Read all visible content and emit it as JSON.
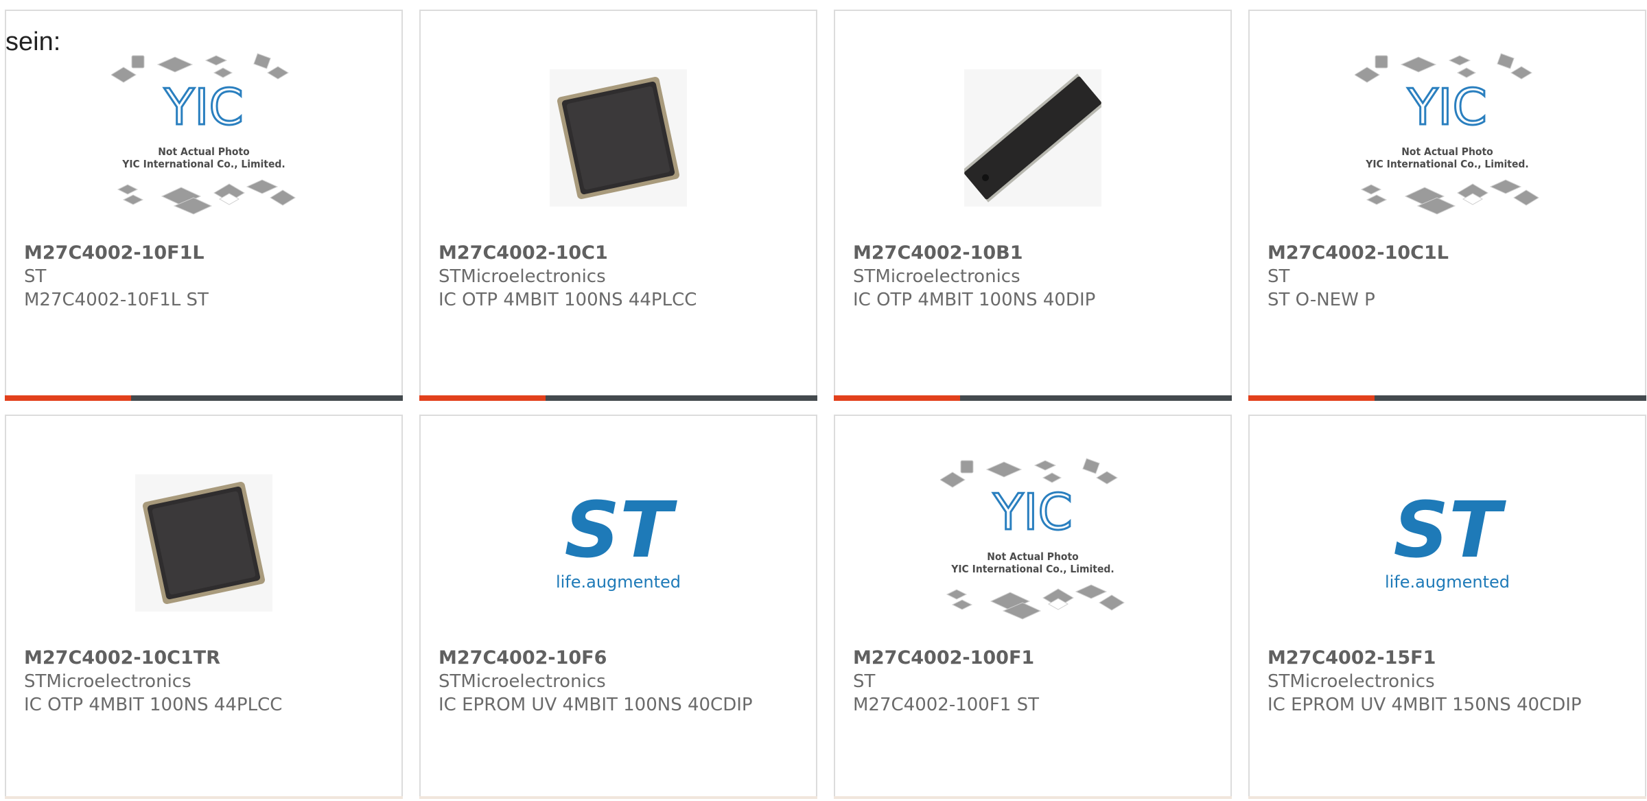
{
  "intro_text": "sein:",
  "colors": {
    "accent": "#e2401c",
    "bar": "#444a4e",
    "st_blue": "#1e7ab8"
  },
  "products": [
    {
      "part": "M27C4002-10F1L",
      "maker": "ST",
      "desc": "M27C4002-10F1L ST",
      "image": "yic-placeholder"
    },
    {
      "part": "M27C4002-10C1",
      "maker": "STMicroelectronics",
      "desc": "IC OTP 4MBIT 100NS 44PLCC",
      "image": "plcc-chip"
    },
    {
      "part": "M27C4002-10B1",
      "maker": "STMicroelectronics",
      "desc": "IC OTP 4MBIT 100NS 40DIP",
      "image": "dip-chip"
    },
    {
      "part": "M27C4002-10C1L",
      "maker": "ST",
      "desc": "ST O-NEW P",
      "image": "yic-placeholder"
    },
    {
      "part": "M27C4002-10C1TR",
      "maker": "STMicroelectronics",
      "desc": "IC OTP 4MBIT 100NS 44PLCC",
      "image": "plcc-chip"
    },
    {
      "part": "M27C4002-10F6",
      "maker": "STMicroelectronics",
      "desc": "IC EPROM UV 4MBIT 100NS 40CDIP",
      "image": "st-logo"
    },
    {
      "part": "M27C4002-100F1",
      "maker": "ST",
      "desc": "M27C4002-100F1 ST",
      "image": "yic-placeholder"
    },
    {
      "part": "M27C4002-15F1",
      "maker": "STMicroelectronics",
      "desc": "IC EPROM UV 4MBIT 150NS 40CDIP",
      "image": "st-logo"
    }
  ],
  "yic": {
    "logo_text": "YIC",
    "line1": "Not Actual Photo",
    "line2": "YIC International Co., Limited."
  },
  "st_logo": {
    "mark": "ST",
    "tagline": "life.augmented"
  }
}
